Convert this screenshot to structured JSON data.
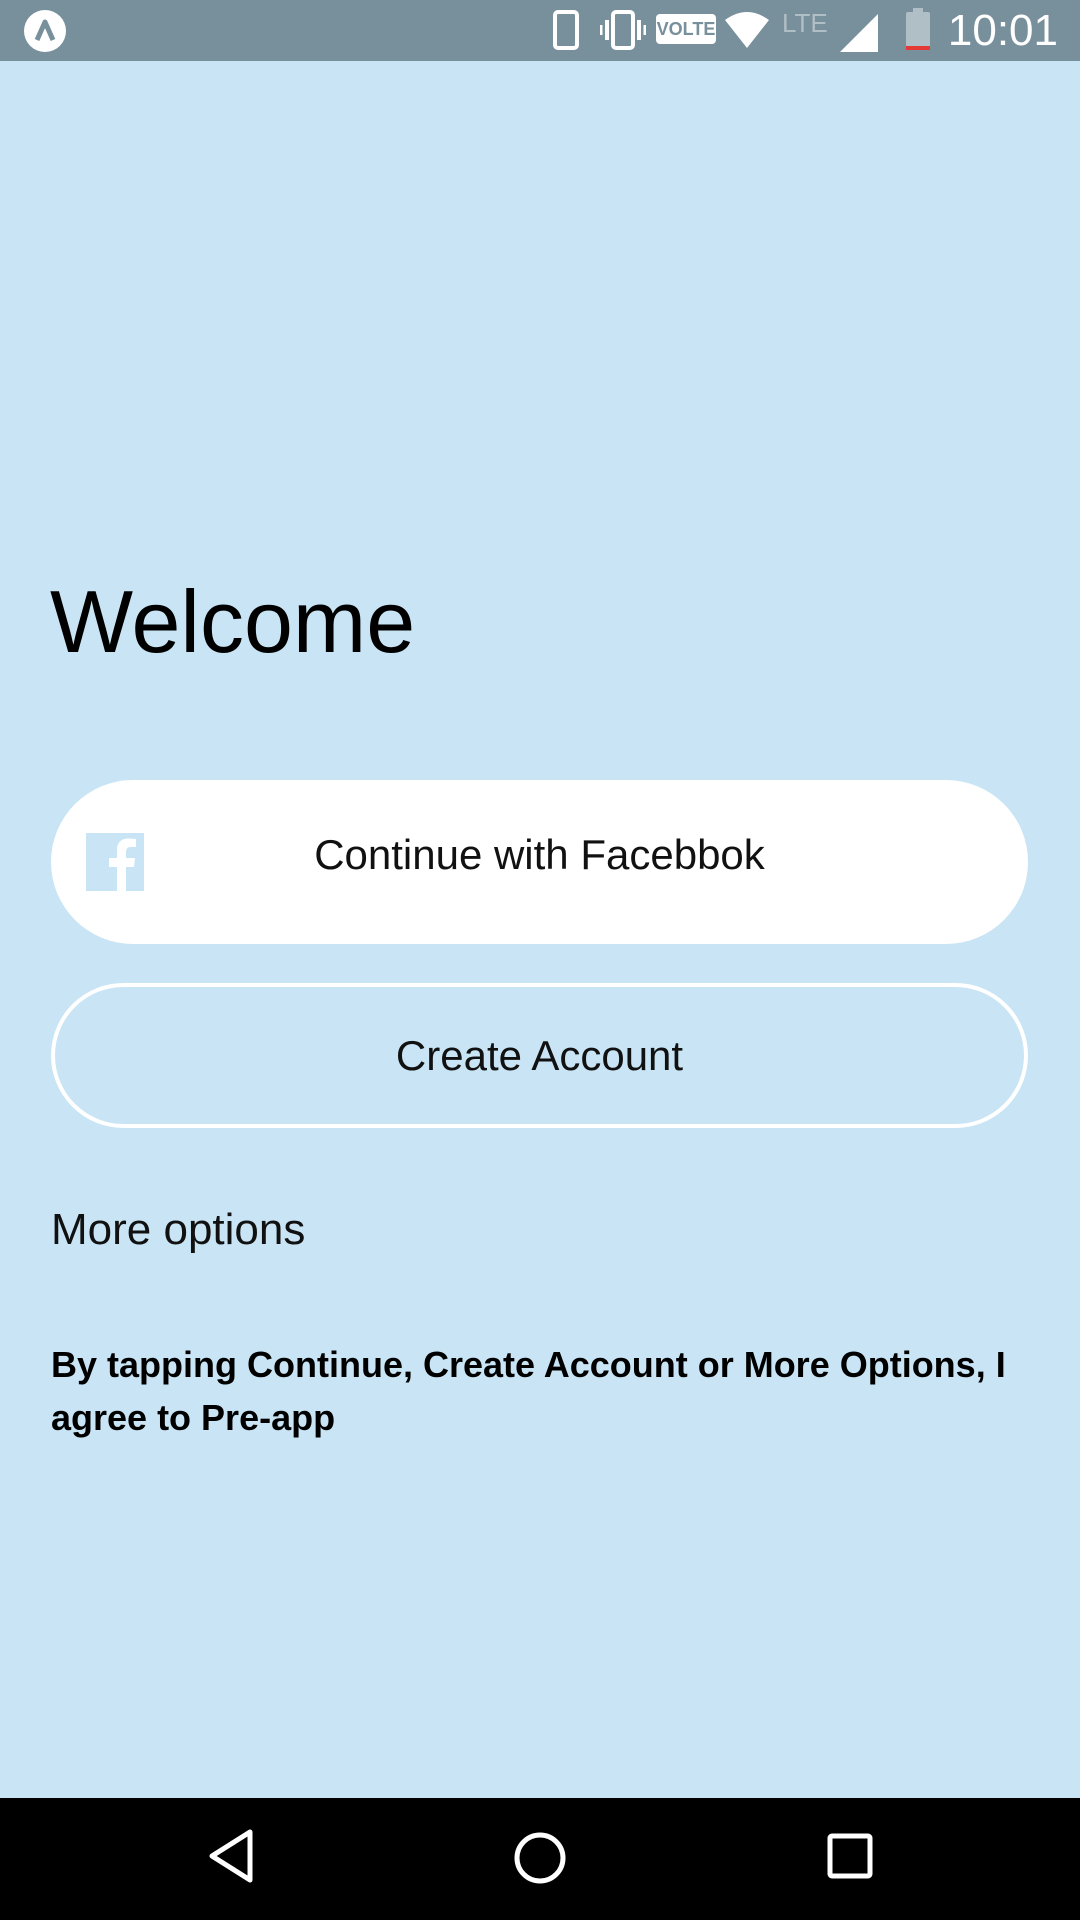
{
  "status_bar": {
    "time": "10:01",
    "volte_label": "VOLTE",
    "network_label": "LTE",
    "icons": [
      "app-badge-icon",
      "phone-icon",
      "vibrate-icon",
      "volte-icon",
      "wifi-icon",
      "lte-icon",
      "cell-signal-icon",
      "battery-icon"
    ]
  },
  "main": {
    "title": "Welcome",
    "facebook_button_label": "Continue with Facebbok",
    "facebook_icon": "facebook-icon",
    "create_account_label": "Create Account",
    "more_options_label": "More options",
    "terms_text": "By tapping Continue, Create Account or More Options, I agree to Pre-app"
  },
  "nav_bar": {
    "icons": [
      "back-icon",
      "home-icon",
      "recents-icon"
    ]
  },
  "colors": {
    "background": "#c9e5f5",
    "status_bar": "#78909c",
    "button_fill": "#ffffff",
    "nav_bar": "#000000",
    "facebook_icon": "#c9e5f5"
  }
}
